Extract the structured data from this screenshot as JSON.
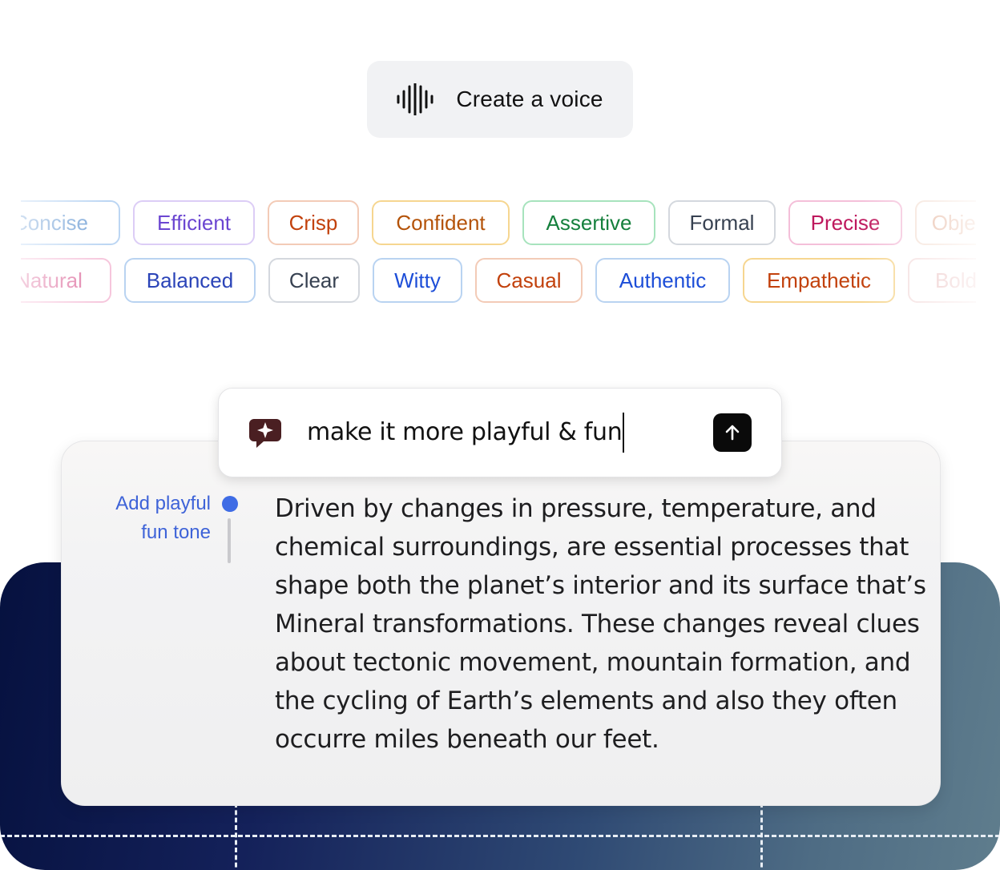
{
  "create_button": {
    "label": "Create a voice",
    "icon": "waveform-icon"
  },
  "tone_chips": {
    "row1": [
      {
        "label": "Concise",
        "text": "#7aa6d8",
        "border": "#bcd6f3"
      },
      {
        "label": "Efficient",
        "text": "#6b46d1",
        "border": "#dccdf6"
      },
      {
        "label": "Crisp",
        "text": "#c2410c",
        "border": "#f3cbb7"
      },
      {
        "label": "Confident",
        "text": "#b45309",
        "border": "#f6d690"
      },
      {
        "label": "Assertive",
        "text": "#15803d",
        "border": "#a7e3bd"
      },
      {
        "label": "Formal",
        "text": "#374151",
        "border": "#d4d8de"
      },
      {
        "label": "Precise",
        "text": "#be185d",
        "border": "#f4bfd9"
      },
      {
        "label": "Objective",
        "text": "#e0a589",
        "border": "#f3dccf"
      }
    ],
    "row2": [
      {
        "label": "Natural",
        "text": "#e07aa6",
        "border": "#f6c6dc"
      },
      {
        "label": "Balanced",
        "text": "#2b44b8",
        "border": "#b9d3f1"
      },
      {
        "label": "Clear",
        "text": "#374151",
        "border": "#d4d8de"
      },
      {
        "label": "Witty",
        "text": "#1d4ed8",
        "border": "#b9d3f1"
      },
      {
        "label": "Casual",
        "text": "#c2410c",
        "border": "#f3cbb7"
      },
      {
        "label": "Authentic",
        "text": "#1d4ed8",
        "border": "#b9d3f1"
      },
      {
        "label": "Empathetic",
        "text": "#c2410c",
        "border": "#f6d690"
      },
      {
        "label": "Bold",
        "text": "#e6b3b3",
        "border": "#f3dada"
      }
    ]
  },
  "prompt": {
    "value": "make it more playful & fun",
    "icon": "sparkle-chat-icon",
    "send_icon": "arrow-up-icon"
  },
  "document": {
    "annotation": "Add playful fun tone",
    "text": "Driven by changes in pressure, temperature, and chemical surroundings, are essential processes that shape both the planet’s interior and its surface that’s Mineral transformations. These changes reveal clues about tectonic movement, mountain formation, and the cycling of Earth’s elements and also they often occurre miles beneath our feet."
  },
  "colors": {
    "accent": "#3f6ce5",
    "panel_gradient_start": "#06113f",
    "panel_gradient_end": "#5f7d8d"
  }
}
